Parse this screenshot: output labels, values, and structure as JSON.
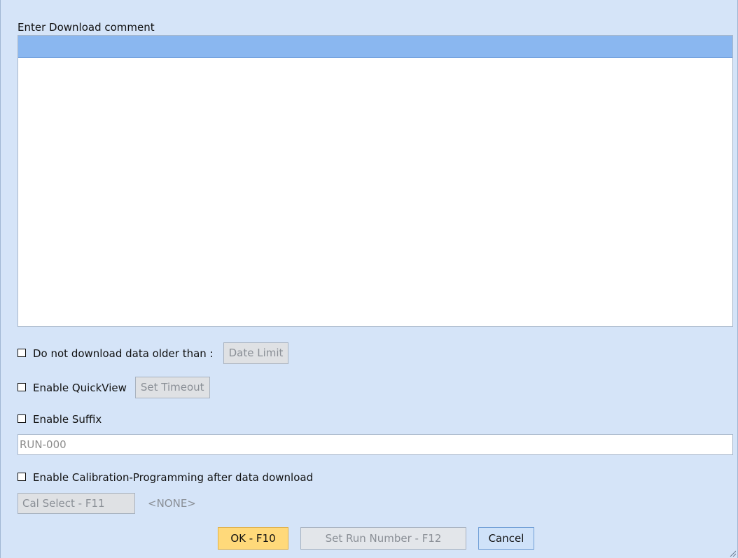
{
  "comment": {
    "label": "Enter Download comment",
    "value": ""
  },
  "date_limit": {
    "label": "Do not download data older than :",
    "checked": false,
    "button": "Date Limit"
  },
  "quickview": {
    "label": "Enable QuickView",
    "checked": false,
    "button": "Set Timeout"
  },
  "suffix": {
    "label": "Enable Suffix",
    "checked": false,
    "value": "RUN-000"
  },
  "calibration": {
    "label": "Enable Calibration-Programming after data download",
    "checked": false,
    "button": "Cal Select - F11",
    "selected": "<NONE>"
  },
  "footer": {
    "ok": "OK - F10",
    "run_number": "Set Run Number - F12",
    "cancel": "Cancel"
  }
}
